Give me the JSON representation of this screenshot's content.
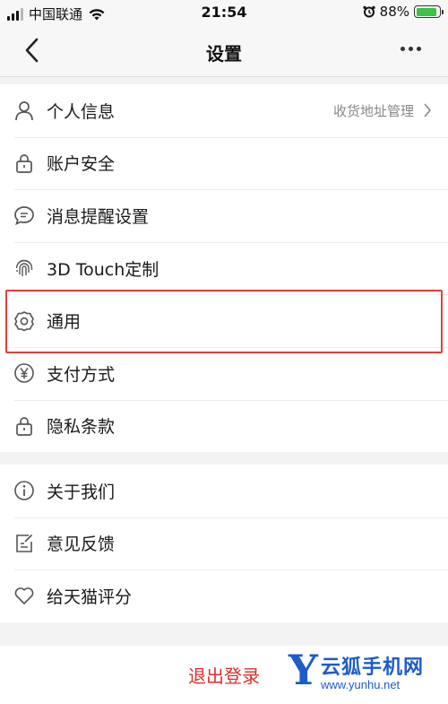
{
  "status_bar": {
    "carrier": "中国联通",
    "time": "21:54",
    "battery": "88%",
    "battery_level": 0.88
  },
  "nav": {
    "title": "设置"
  },
  "group1": [
    {
      "label": "个人信息",
      "icon": "person-icon",
      "hint": "收货地址管理"
    },
    {
      "label": "账户安全",
      "icon": "lock-icon"
    },
    {
      "label": "消息提醒设置",
      "icon": "message-icon"
    },
    {
      "label": "3D Touch定制",
      "icon": "fingerprint-icon"
    },
    {
      "label": "通用",
      "icon": "gear-icon"
    },
    {
      "label": "支付方式",
      "icon": "yen-icon"
    },
    {
      "label": "隐私条款",
      "icon": "lock-icon"
    }
  ],
  "group2": [
    {
      "label": "关于我们",
      "icon": "info-icon"
    },
    {
      "label": "意见反馈",
      "icon": "edit-icon"
    },
    {
      "label": "给天猫评分",
      "icon": "heart-icon"
    }
  ],
  "logout_label": "退出登录",
  "watermark": {
    "letter": "Y",
    "name": "云狐手机网",
    "url": "www.yunhu.net"
  },
  "colors": {
    "accent_red": "#d9302f",
    "highlight": "#e04040",
    "battery_green": "#3fc146",
    "watermark_blue": "#1e5cc8"
  }
}
